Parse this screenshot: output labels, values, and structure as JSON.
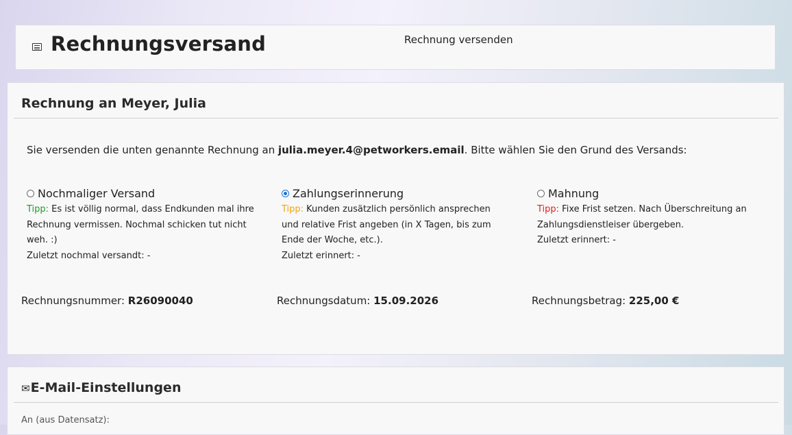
{
  "header": {
    "title": "Rechnungsversand",
    "subtitle": "Rechnung versenden",
    "icon": "list-icon"
  },
  "invoice": {
    "title": "Rechnung an Meyer, Julia",
    "intro_prefix": "Sie versenden die unten genannte Rechnung an ",
    "email": "julia.meyer.4@petworkers.email",
    "intro_suffix": ". Bitte wählen Sie den Grund des Versands:",
    "options": [
      {
        "label": "Nochmaliger Versand",
        "checked": false,
        "tip_label": "Tipp:",
        "tip_color": "#1f9a27",
        "tip_text": " Es ist völlig normal, dass Endkunden mal ihre Rechnung vermissen. Nochmal schicken tut nicht weh. :)",
        "last": "Zuletzt nochmal versandt: -"
      },
      {
        "label": "Zahlungserinnerung",
        "checked": true,
        "tip_label": "Tipp:",
        "tip_color": "#f0a40e",
        "tip_text": " Kunden zusätzlich persönlich ansprechen und relative Frist angeben (in X Tagen, bis zum Ende der Woche, etc.).",
        "last": "Zuletzt erinnert: -"
      },
      {
        "label": "Mahnung",
        "checked": false,
        "tip_label": "Tipp:",
        "tip_color": "#e3201b",
        "tip_text": " Fixe Frist setzen. Nach Überschreitung an Zahlungsdienstleiser übergeben.",
        "last": "Zuletzt erinnert: -"
      }
    ],
    "number_label": "Rechnungsnummer: ",
    "number_value": "R26090040",
    "date_label": "Rechnungsdatum: ",
    "date_value": "15.09.2026",
    "amount_label": "Rechnungsbetrag: ",
    "amount_value": "225,00 €"
  },
  "email_settings": {
    "icon": "envelope-icon",
    "icon_glyph": "✉",
    "title": "E-Mail-Einstellungen",
    "to_label": "An (aus Datensatz):"
  }
}
